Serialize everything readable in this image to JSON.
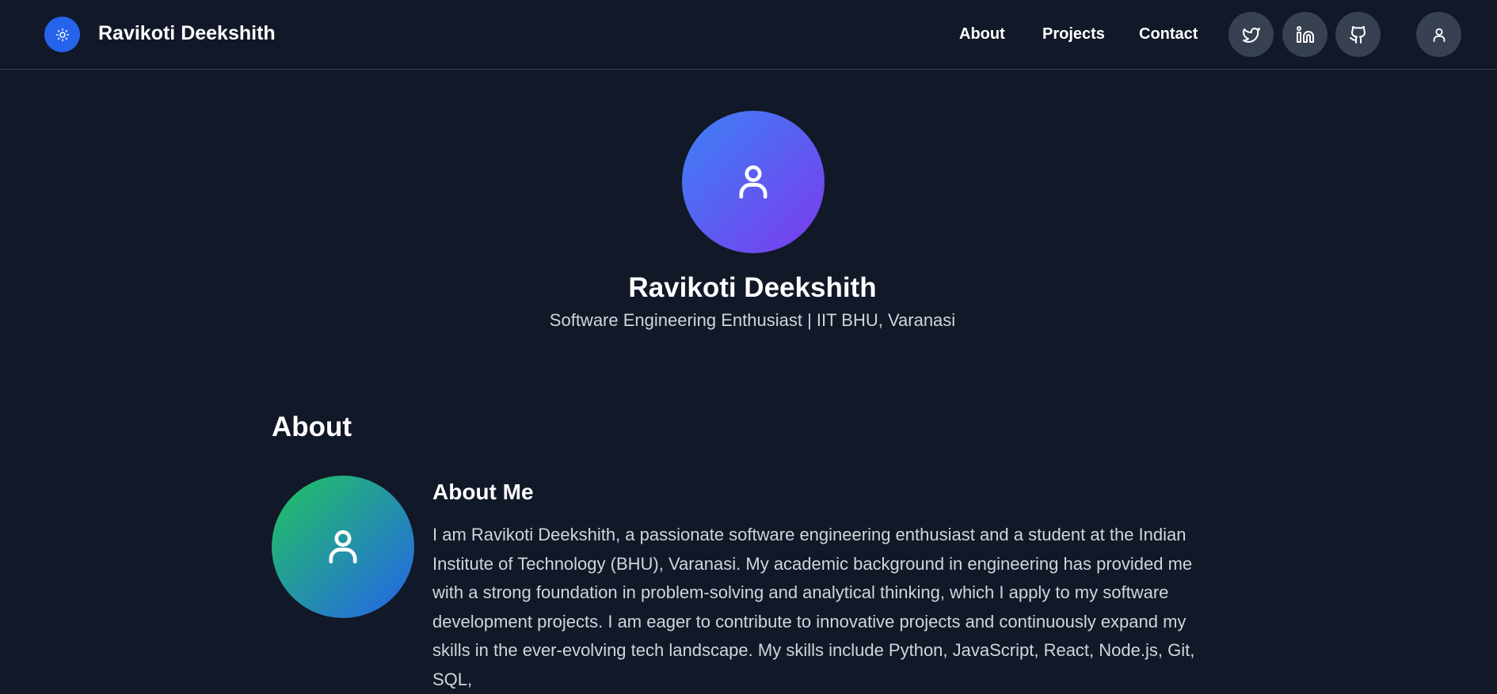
{
  "header": {
    "site_title": "Ravikoti Deekshith",
    "theme_icon": "sun-icon",
    "nav": [
      {
        "label": "About"
      },
      {
        "label": "Projects"
      },
      {
        "label": "Contact"
      }
    ],
    "social": [
      {
        "icon": "twitter-icon"
      },
      {
        "icon": "linkedin-icon"
      },
      {
        "icon": "github-icon"
      }
    ],
    "profile_icon": "user-icon"
  },
  "hero": {
    "name": "Ravikoti Deekshith",
    "tagline": "Software Engineering Enthusiast | IIT BHU, Varanasi",
    "avatar_icon": "user-icon"
  },
  "about": {
    "section_title": "About",
    "heading": "About Me",
    "avatar_icon": "user-icon",
    "paragraph": "I am Ravikoti Deekshith, a passionate software engineering enthusiast and a student at the Indian Institute of Technology (BHU), Varanasi. My academic background in engineering has provided me with a strong foundation in problem-solving and analytical thinking, which I apply to my software development projects. I am eager to contribute to innovative projects and continuously expand my skills in the ever-evolving tech landscape. My skills include Python, JavaScript, React, Node.js, Git, SQL,"
  },
  "colors": {
    "background": "#111827",
    "accent": "#2563eb",
    "button_bg": "#374151",
    "text_muted": "#d1d5db",
    "hero_gradient": [
      "#3b82f6",
      "#7c3aed"
    ],
    "about_gradient": [
      "#22c55e",
      "#2563eb"
    ]
  }
}
